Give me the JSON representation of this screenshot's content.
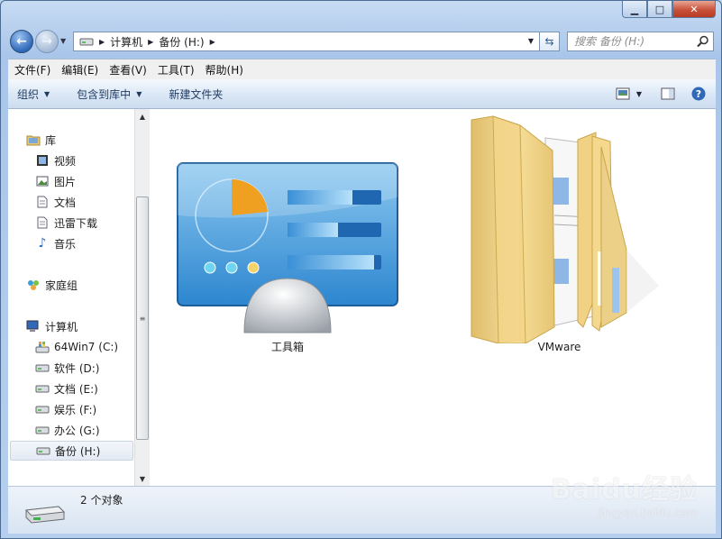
{
  "address": {
    "crumbs": [
      "计算机",
      "备份 (H:)"
    ]
  },
  "search": {
    "placeholder": "搜索 备份 (H:)"
  },
  "menubar": {
    "items": [
      "文件(F)",
      "编辑(E)",
      "查看(V)",
      "工具(T)",
      "帮助(H)"
    ]
  },
  "toolbar": {
    "organize": "组织",
    "include_library": "包含到库中",
    "new_folder": "新建文件夹"
  },
  "navpane": {
    "libraries": {
      "label": "库",
      "items": [
        "视频",
        "图片",
        "文档",
        "迅雷下载",
        "音乐"
      ]
    },
    "homegroup": "家庭组",
    "computer": {
      "label": "计算机",
      "drives": [
        "64Win7  (C:)",
        "软件 (D:)",
        "文档 (E:)",
        "娱乐 (F:)",
        "办公 (G:)",
        "备份 (H:)"
      ],
      "selected": "备份 (H:)"
    }
  },
  "content": {
    "items": [
      {
        "name": "工具箱",
        "icon": "control-panel-icon"
      },
      {
        "name": "VMware",
        "icon": "folder-icon"
      }
    ]
  },
  "status": {
    "count_text": "2 个对象"
  },
  "watermark": {
    "brand": "Baidu经验",
    "url": "jingyan.baidu.com"
  },
  "colors": {
    "accent": "#2f69b8",
    "folder": "#f2d98c",
    "panel_blue": "#3a8fd6"
  }
}
